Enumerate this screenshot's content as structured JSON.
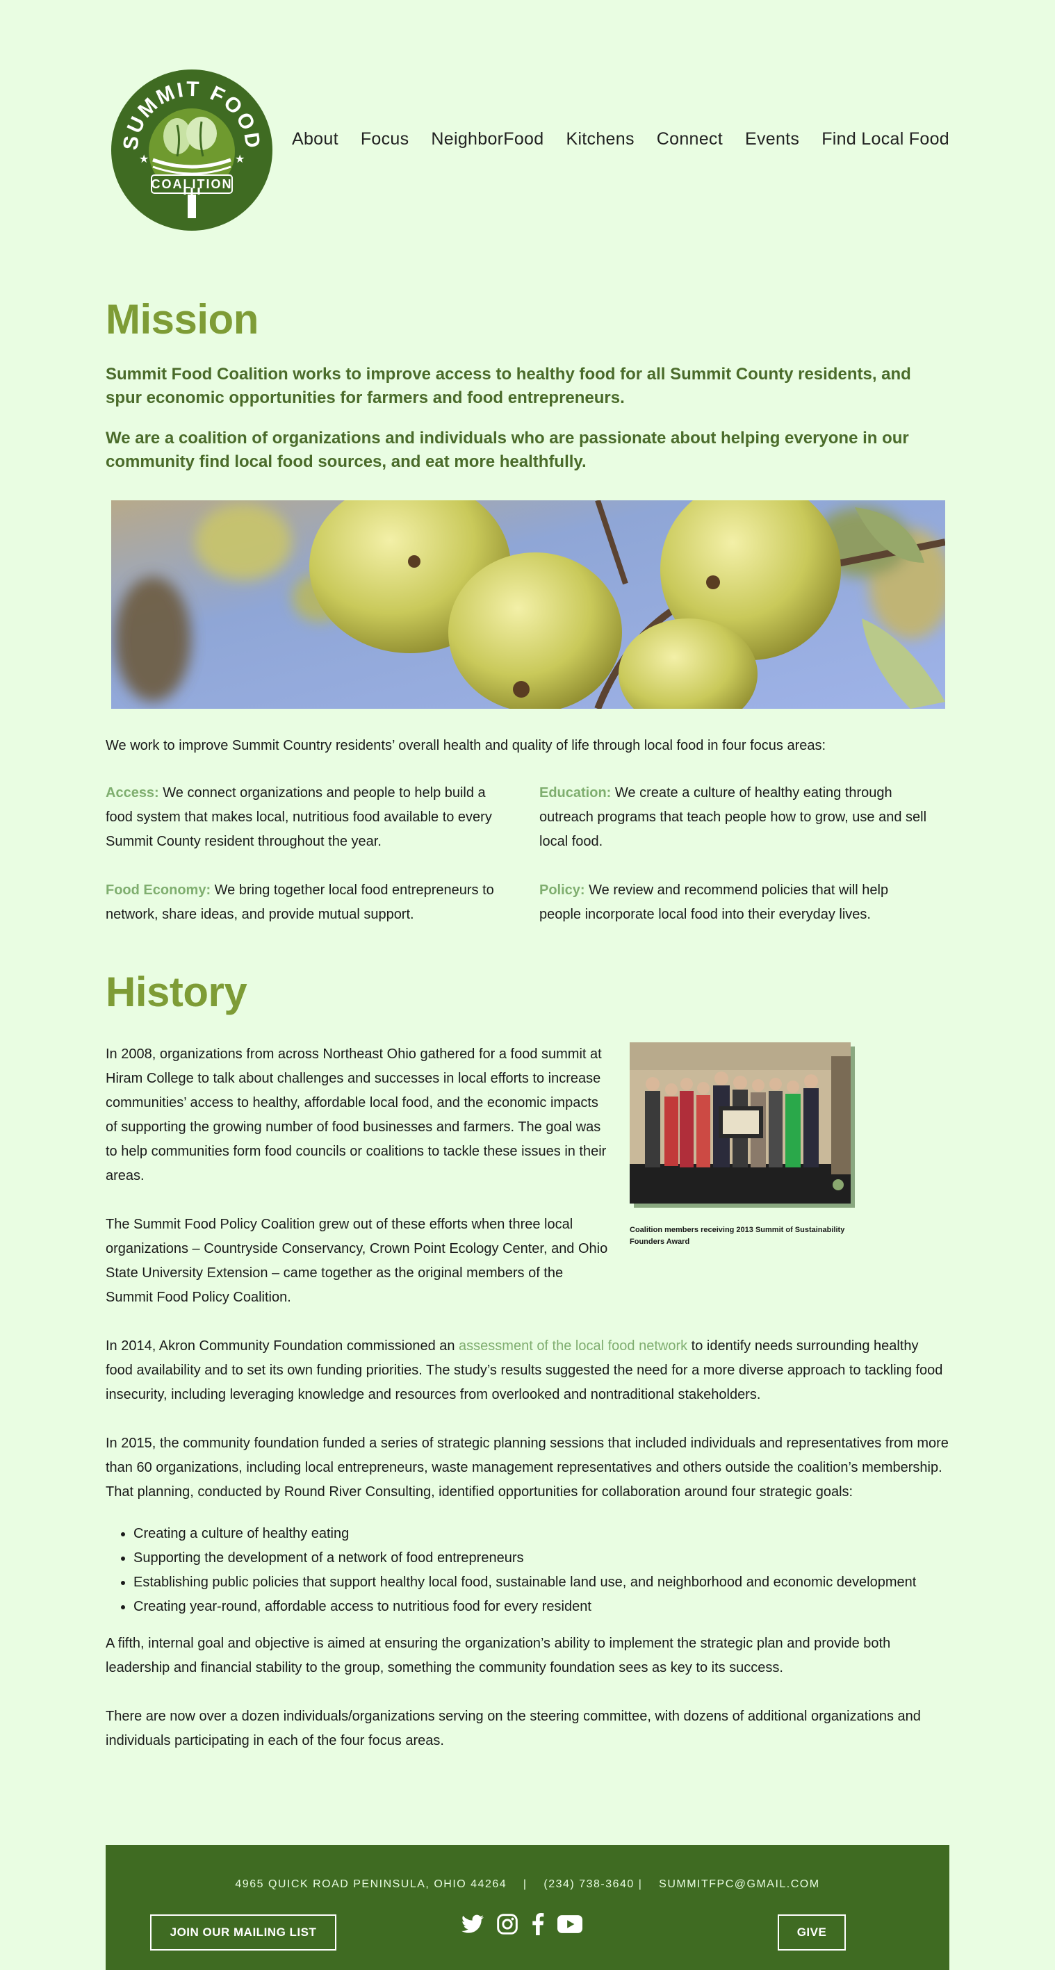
{
  "logo": {
    "top_text": "SUMMIT FOOD",
    "banner_text": "COALITION"
  },
  "nav": [
    "About",
    "Focus",
    "NeighborFood",
    "Kitchens",
    "Connect",
    "Events",
    "Find Local Food"
  ],
  "mission": {
    "title": "Mission",
    "lead1": "Summit Food Coalition works to improve access to healthy food for all Summit County residents, and spur economic opportunities for farmers and food entrepreneurs.",
    "lead2": "We are a coalition of organizations and individuals who are passionate about helping everyone in our community find local food sources, and eat more healthfully.",
    "intro": "We work to improve Summit Country residents’ overall health and quality of life through local food in four focus areas:",
    "areas": [
      {
        "label": "Access:",
        "text": " We connect organizations and people to help build a food system that makes local, nutritious food available to every Summit County resident throughout the year."
      },
      {
        "label": "Food Economy:",
        "text": " We bring together local food entrepreneurs to network, share ideas, and provide mutual support."
      },
      {
        "label": "Education:",
        "text": " We create a culture of healthy eating through outreach programs that teach people how to grow, use and sell local food."
      },
      {
        "label": "Policy:",
        "text": " We review and recommend policies that will help people incorporate local food into their everyday lives."
      }
    ]
  },
  "history": {
    "title": "History",
    "caption": "Coalition members receiving 2013 Summit of Sustainability Founders Award",
    "p1": "In 2008, organizations from across Northeast Ohio gathered for a food summit at Hiram College to talk about challenges and successes in local efforts to increase communities’ access to healthy, affordable local food, and the economic impacts of supporting the growing number of food businesses and farmers. The goal was to help communities form food councils or coalitions to tackle these issues in their areas.",
    "p2": "The Summit Food Policy Coalition grew out of these efforts when three local organizations – Countryside Conservancy, Crown Point Ecology Center, and Ohio State University Extension – came together as the original members of the Summit Food Policy Coalition.",
    "p3_before": "In 2014, Akron Community Foundation commissioned an ",
    "p3_link": "assessment of the local food network",
    "p3_after": " to identify needs surrounding healthy food availability and to set its own funding priorities. The study’s results suggested the need for a more diverse approach to tackling food insecurity, including leveraging knowledge and resources from overlooked and nontraditional stakeholders.",
    "p4": "In 2015, the community foundation funded a series of strategic planning sessions that included individuals and representatives from more than 60 organizations, including local entrepreneurs, waste management representatives and others outside the coalition’s membership. That planning, conducted by Round River Consulting, identified opportunities for collaboration around four strategic goals:",
    "goals": [
      "Creating a culture of healthy eating",
      "Supporting the development of a network of food entrepreneurs",
      "Establishing public policies that support healthy local food, sustainable land use, and neighborhood and economic development",
      "Creating year-round, affordable access to nutritious food for every resident"
    ],
    "p5": "A fifth, internal goal and objective is aimed at ensuring the organization’s ability to implement the strategic plan and provide both leadership and financial stability to the group, something the community foundation sees as key to its success.",
    "p6": "There are now over a dozen individuals/organizations serving on the steering committee, with dozens of additional organizations and individuals participating in each of the four focus areas."
  },
  "footer": {
    "contact": "4965 QUICK ROAD PENINSULA, OHIO 44264    |    (234) 738-3640 |    SUMMITFPC@GMAIL.COM",
    "mailing_button": "JOIN OUR MAILING LIST",
    "give_button": "GIVE",
    "social_icons": [
      "twitter-icon",
      "instagram-icon",
      "facebook-icon",
      "youtube-icon"
    ]
  },
  "colors": {
    "background": "#e9fde2",
    "heading": "#7e9c36",
    "lead": "#4a6b2a",
    "accent": "#7fae6f",
    "footer": "#3f6b22"
  }
}
